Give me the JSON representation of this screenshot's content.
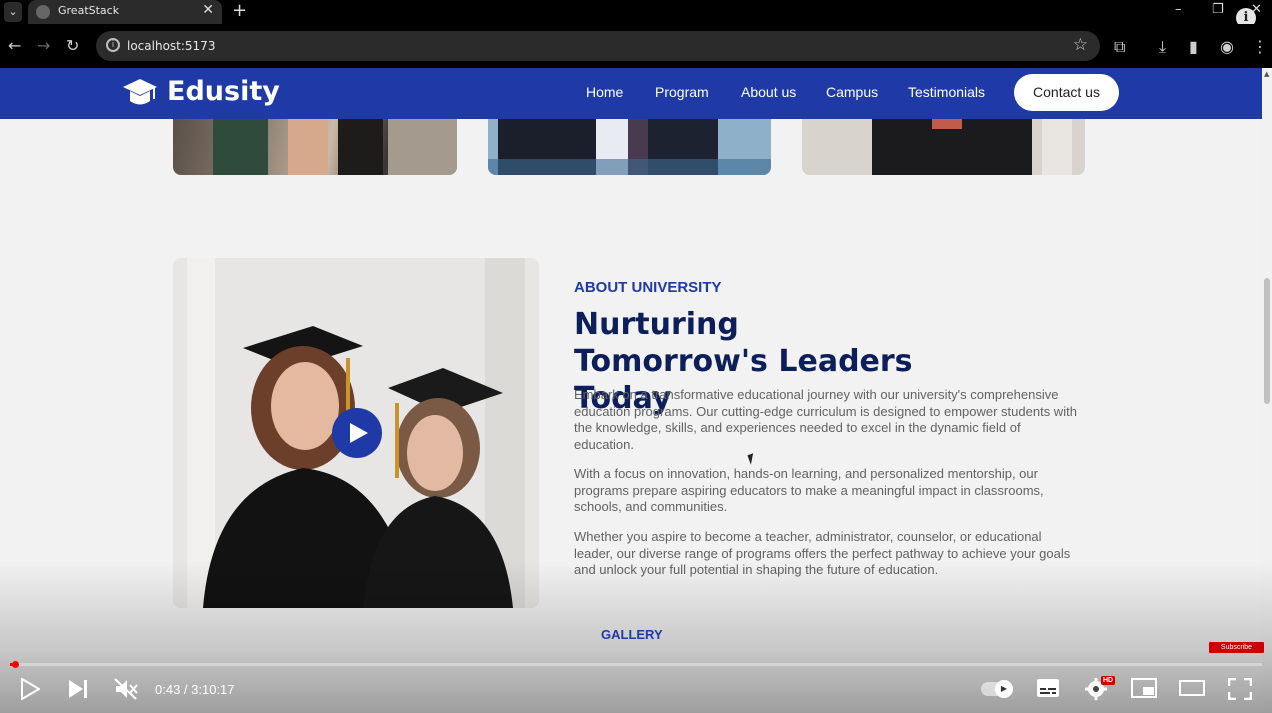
{
  "browser": {
    "tab_title": "GreatStack",
    "tab_close": "✕",
    "new_tab": "+",
    "url": "localhost:5173",
    "window_controls": {
      "minimize": "–",
      "restore": "❐",
      "close": "✕"
    }
  },
  "site": {
    "logo_text": "Edusity",
    "nav": [
      "Home",
      "Program",
      "About us",
      "Campus",
      "Testimonials"
    ],
    "contact_button": "Contact us",
    "brand_color": "#1f3aa6"
  },
  "about": {
    "eyebrow": "ABOUT UNIVERSITY",
    "heading": "Nurturing Tomorrow's Leaders Today",
    "paragraphs": [
      "Embark on a transformative educational journey with our university's comprehensive education programs. Our cutting-edge curriculum is designed to empower students with the knowledge, skills, and experiences needed to excel in the dynamic field of education.",
      "With a focus on innovation, hands-on learning, and personalized mentorship, our programs prepare aspiring educators to make a meaningful impact in classrooms, schools, and communities.",
      "Whether you aspire to become a teacher, administrator, counselor, or educational leader, our diverse range of programs offers the perfect pathway to achieve your goals and unlock your full potential in shaping the future of education."
    ]
  },
  "gallery": {
    "label": "GALLERY"
  },
  "player": {
    "time": "0:43 / 3:10:17",
    "progress_fraction": 0.004,
    "subscribe": "Subscribe",
    "hd_badge": "HD"
  }
}
